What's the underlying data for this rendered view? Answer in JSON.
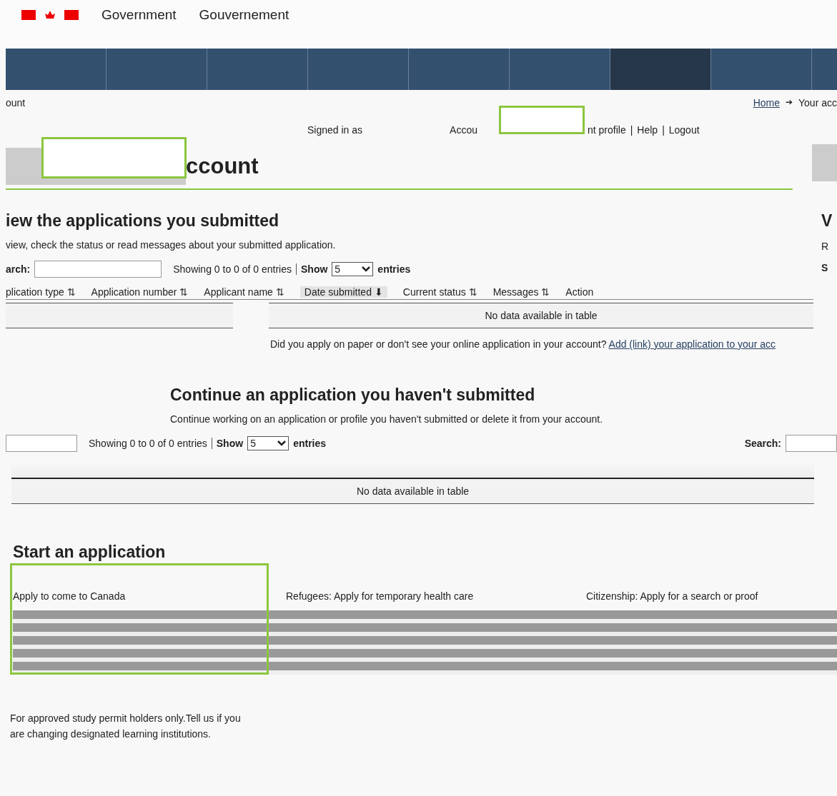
{
  "header": {
    "gov_en": "Government",
    "gov_fr": "Gouvernement"
  },
  "nav": {
    "items": [
      {
        "selected": false
      },
      {
        "selected": false
      },
      {
        "selected": false
      },
      {
        "selected": false
      },
      {
        "selected": false
      },
      {
        "selected": false
      },
      {
        "selected": true
      },
      {
        "selected": false
      }
    ]
  },
  "breadcrumb": {
    "current": "ount",
    "links": [
      "Home",
      "Your acc"
    ],
    "separator": "➔"
  },
  "account_bar": {
    "signed_in": "Signed in as",
    "links": [
      "Accou",
      "nt profile",
      "Help",
      "Logout"
    ],
    "separator": "|"
  },
  "page_title": "ccount",
  "submitted": {
    "heading": "iew the applications you submitted",
    "intro": "view, check the status or read messages about your submitted application.",
    "search_label": "arch:",
    "info": "Showing 0 to 0 of 0 entries",
    "show_label": "Show",
    "show_value": "5",
    "entries_label": "entries",
    "columns": [
      {
        "label": "plication type",
        "sort_icon": "⇅",
        "sorted": false
      },
      {
        "label": "Application number",
        "sort_icon": "⇅",
        "sorted": false
      },
      {
        "label": "Applicant name",
        "sort_icon": "⇅",
        "sorted": false
      },
      {
        "label": "Date submitted",
        "sort_icon": "⬇",
        "sorted": true
      },
      {
        "label": "Current status",
        "sort_icon": "⇅",
        "sorted": false
      },
      {
        "label": "Messages",
        "sort_icon": "⇅",
        "sorted": false
      },
      {
        "label": "Action",
        "sorted": false
      }
    ],
    "empty": "No data available in table",
    "paper_note": "Did you apply on paper or don't see your online application in your account?",
    "paper_link": "Add (link) your application to your acc"
  },
  "side_panel": {
    "heading": "V",
    "line_1": "R",
    "line_2": "S"
  },
  "unsubmitted": {
    "heading": "Continue an application you haven't submitted",
    "intro": "Continue working on an application or profile you haven't submitted or delete it from your account.",
    "info": "Showing 0 to 0 of 0 entries",
    "show_label": "Show",
    "show_value": "5",
    "entries_label": "entries",
    "search_label": "Search:",
    "empty": "No data available in table"
  },
  "start": {
    "heading": "Start an application",
    "options": [
      "Apply to come to Canada",
      "Refugees: Apply for temporary health care",
      "Citizenship: Apply for a search or proof"
    ],
    "study_note": "For approved study permit holders only.Tell us if you are changing designated learning institutions."
  }
}
